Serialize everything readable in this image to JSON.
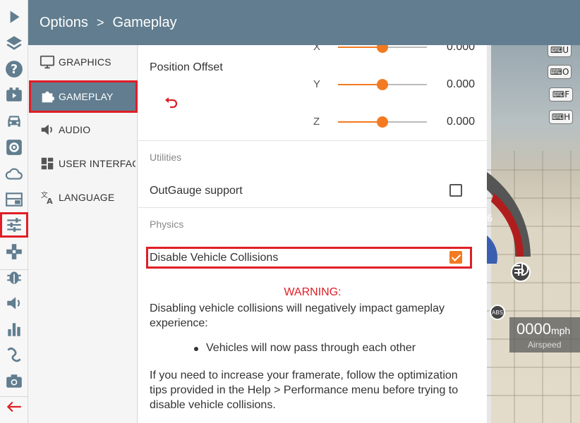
{
  "header": {
    "title": "Options",
    "separator": ">",
    "subtitle": "Gameplay"
  },
  "iconbar": {
    "items": [
      {
        "icon": "play-icon"
      },
      {
        "icon": "layers-icon"
      },
      {
        "icon": "help-icon"
      },
      {
        "icon": "video-icon"
      },
      {
        "icon": "car-icon"
      },
      {
        "icon": "gear-icon"
      },
      {
        "icon": "cloud-icon"
      },
      {
        "icon": "layout-icon"
      },
      {
        "icon": "sliders-icon",
        "active": true
      },
      {
        "icon": "gamepad-icon"
      },
      {
        "icon": "bug-icon"
      },
      {
        "icon": "volume-icon"
      },
      {
        "icon": "bar-chart-icon"
      },
      {
        "icon": "route-icon"
      },
      {
        "icon": "camera-icon"
      },
      {
        "icon": "back-arrow-icon"
      }
    ]
  },
  "categories": [
    {
      "label": "GRAPHICS",
      "icon": "monitor-icon"
    },
    {
      "label": "GAMEPLAY",
      "icon": "puzzle-icon",
      "active": true
    },
    {
      "label": "AUDIO",
      "icon": "speaker-icon"
    },
    {
      "label": "USER INTERFAC",
      "icon": "dashboard-icon"
    },
    {
      "label": "LANGUAGE",
      "icon": "translate-icon"
    }
  ],
  "position_offset": {
    "label": "Position Offset",
    "reset_icon": "undo-icon",
    "axes": [
      {
        "axis": "X",
        "value": "0.000",
        "fraction": 0.5
      },
      {
        "axis": "Y",
        "value": "0.000",
        "fraction": 0.5
      },
      {
        "axis": "Z",
        "value": "0.000",
        "fraction": 0.5
      }
    ]
  },
  "utilities": {
    "section": "Utilities",
    "outgauge_label": "OutGauge support",
    "outgauge_checked": false
  },
  "physics": {
    "section": "Physics",
    "collisions_label": "Disable Vehicle Collisions",
    "collisions_checked": true,
    "warning_title": "WARNING:",
    "warning_text": "Disabling vehicle collisions will negatively impact gameplay experience:",
    "bullet": "Vehicles will now pass through each other",
    "tip": "If you need to increase your framerate, follow the optimization tips provided in the Help > Performance menu before trying to disable vehicle collisions."
  },
  "game": {
    "keys": [
      "U",
      "O",
      "F",
      "H"
    ],
    "speed_value": "0000",
    "speed_unit": "mph",
    "speed_label": "Airspeed",
    "gauge_digit": "6",
    "abs_label": "ABS",
    "parking_label": "P"
  },
  "colors": {
    "accent": "#f37a20",
    "header": "#617d8f",
    "highlight": "#e01e26"
  }
}
